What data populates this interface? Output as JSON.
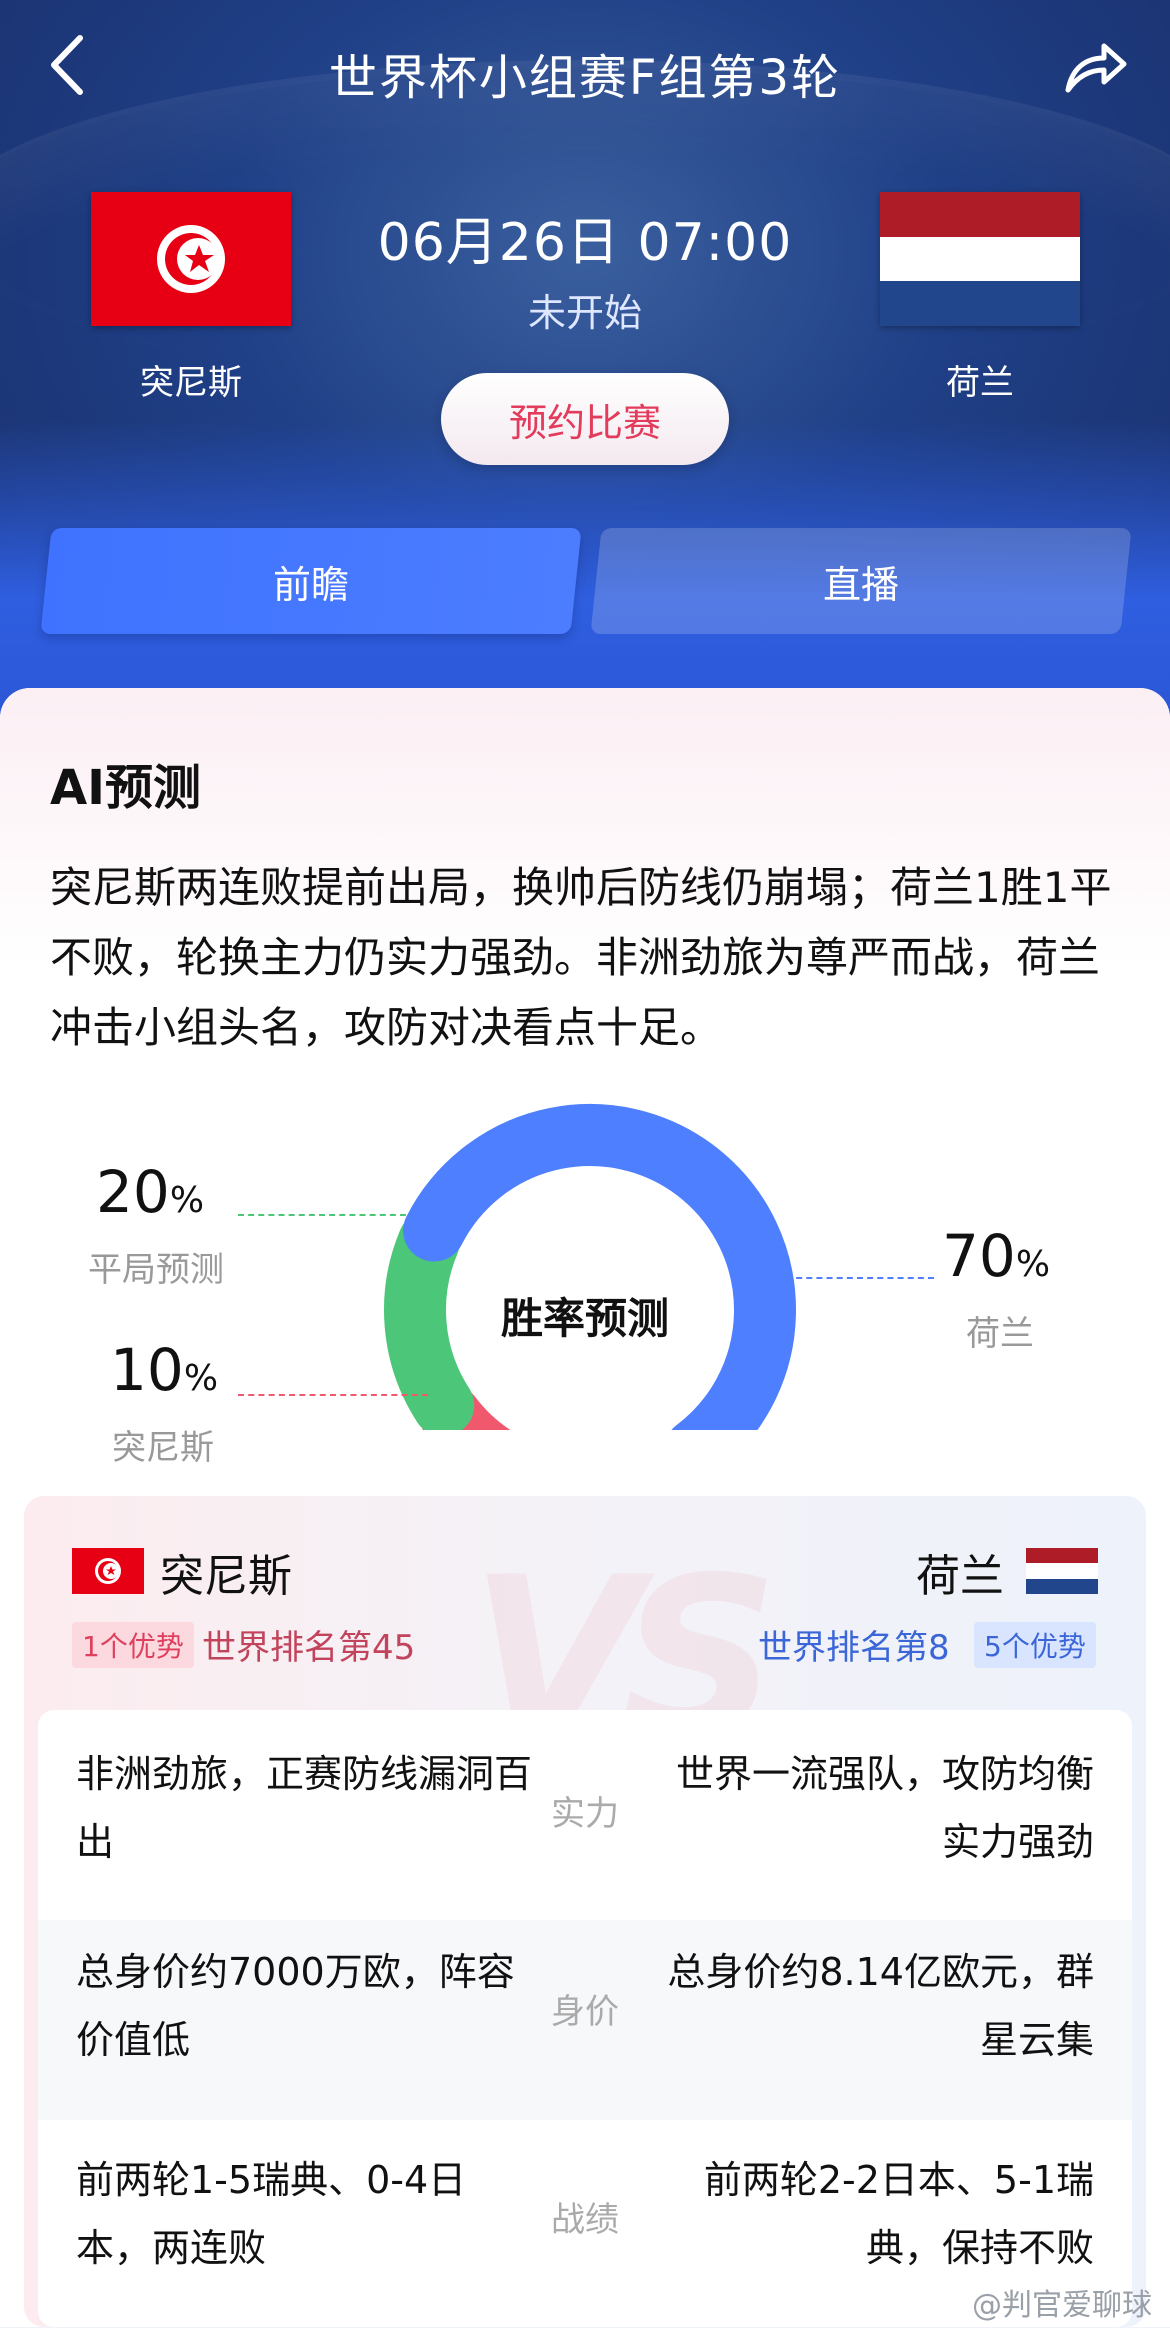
{
  "header": {
    "title": "世界杯小组赛F组第3轮",
    "back_icon": "chevron-left-icon",
    "share_icon": "share-arrow-icon"
  },
  "match": {
    "home_team": "突尼斯",
    "away_team": "荷兰",
    "datetime": "06月26日 07:00",
    "status": "未开始",
    "reserve_label": "预约比赛"
  },
  "tabs": [
    {
      "label": "前瞻",
      "active": true
    },
    {
      "label": "直播",
      "active": false
    }
  ],
  "ai": {
    "title": "AI预测",
    "text": "突尼斯两连败提前出局，换帅后防线仍崩塌；荷兰1胜1平不败，轮换主力仍实力强劲。非洲劲旅为尊严而战，荷兰冲击小组头名，攻防对决看点十足。"
  },
  "chart_data": {
    "type": "pie",
    "title": "胜率预测",
    "categories": [
      "荷兰",
      "平局预测",
      "突尼斯"
    ],
    "values": [
      70,
      20,
      10
    ],
    "unit": "%",
    "colors": [
      "#4d7fff",
      "#4cc77a",
      "#f0586d"
    ]
  },
  "win_prob": {
    "draw": {
      "value": "20",
      "unit": "%",
      "label": "平局预测"
    },
    "home": {
      "value": "10",
      "unit": "%",
      "label": "突尼斯"
    },
    "away": {
      "value": "70",
      "unit": "%",
      "label": "荷兰"
    }
  },
  "compare": {
    "home": {
      "name": "突尼斯",
      "adv": "1个优势",
      "rank": "世界排名第45"
    },
    "away": {
      "name": "荷兰",
      "adv": "5个优势",
      "rank": "世界排名第8"
    },
    "vs_text": "VS",
    "rows": [
      {
        "left": "非洲劲旅，正赛防线漏洞百出",
        "mid": "实力",
        "right": "世界一流强队，攻防均衡实力强劲"
      },
      {
        "left": "总身价约7000万欧，阵容价值低",
        "mid": "身价",
        "right": "总身价约8.14亿欧元，群星云集"
      },
      {
        "left": "前两轮1-5瑞典、0-4日本，两连败",
        "mid": "战绩",
        "right": "前两轮2-2日本、5-1瑞典，保持不败"
      }
    ]
  },
  "watermark": "@判官爱聊球",
  "colors": {
    "accent_blue": "#3f73ff",
    "accent_red": "#e23b5b",
    "tunisia_red": "#e70013",
    "ned_red": "#ae1c28",
    "ned_blue": "#21468b"
  }
}
